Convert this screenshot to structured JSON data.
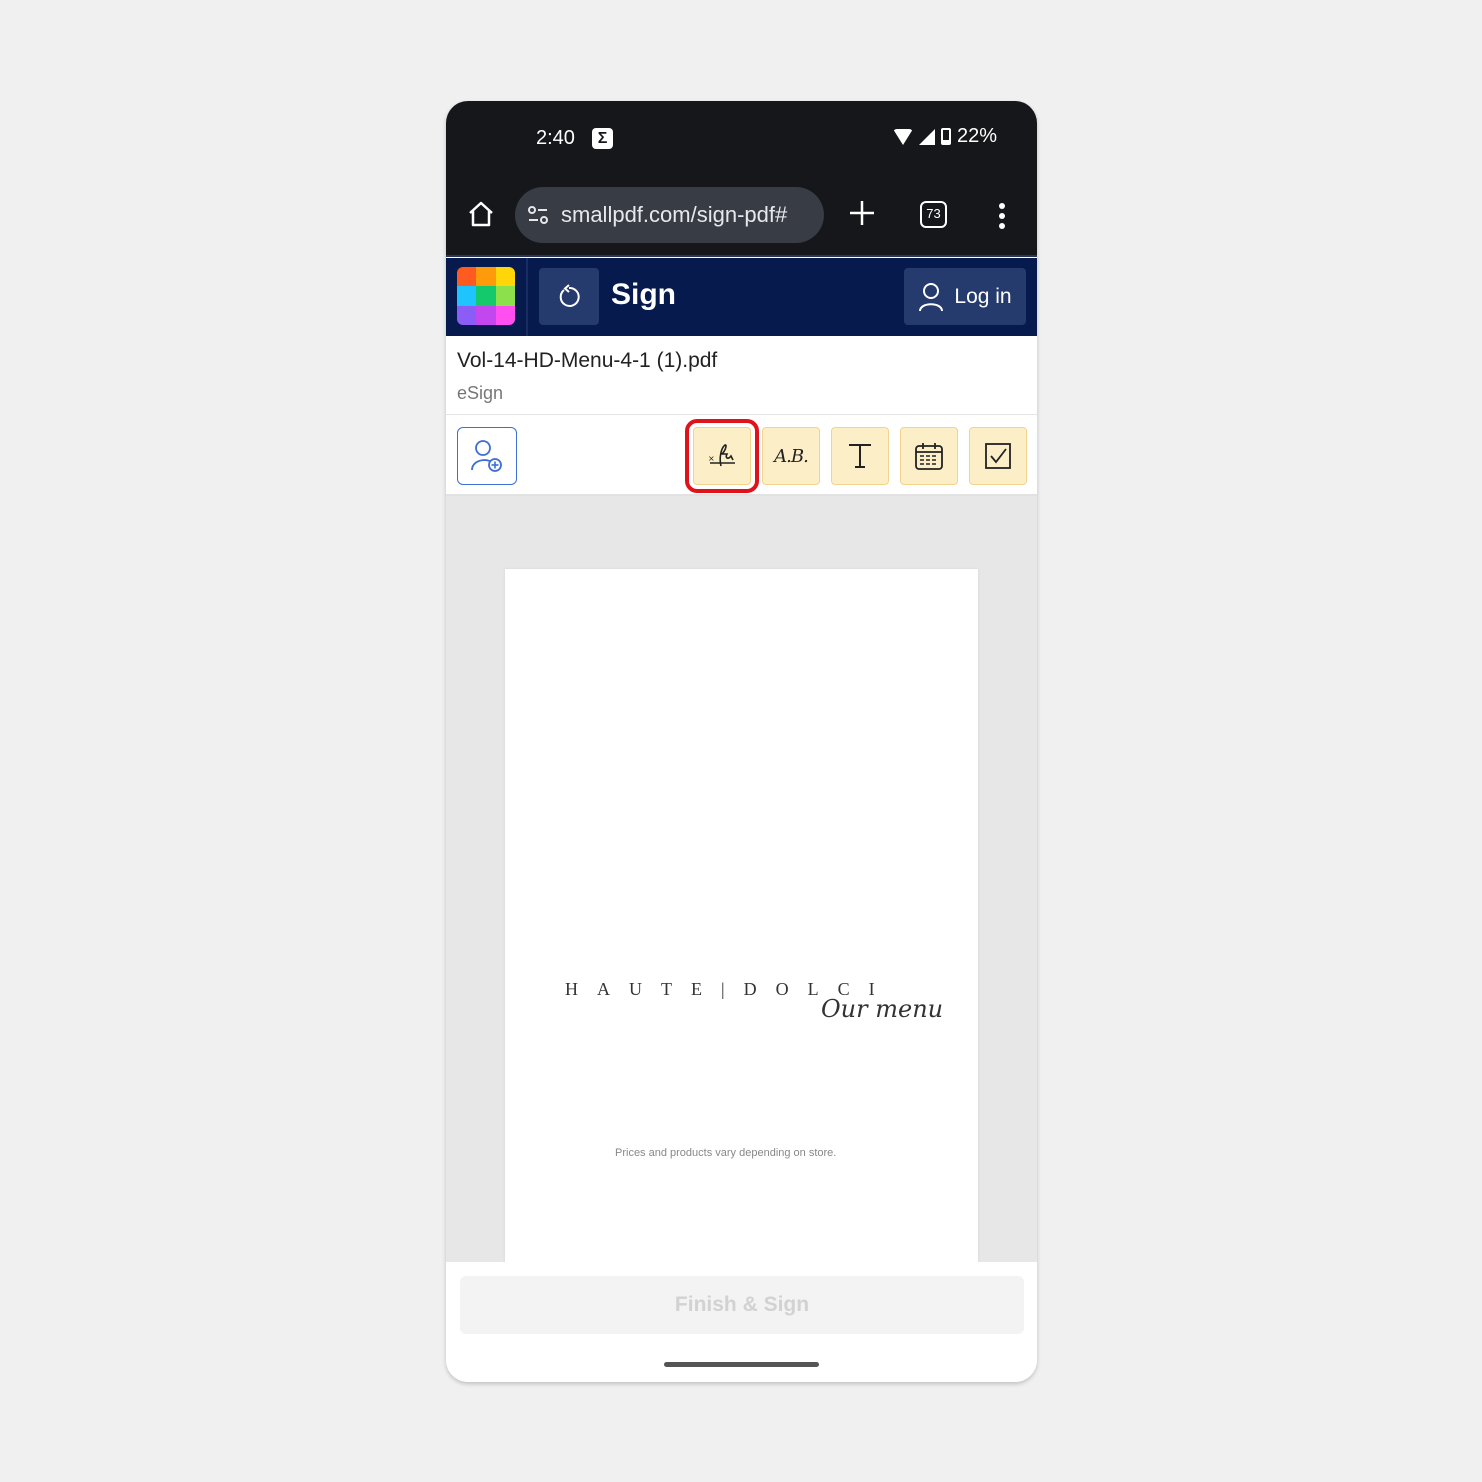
{
  "status_bar": {
    "time": "2:40",
    "notification_icon": "sigma-icon",
    "battery": "22%"
  },
  "browser": {
    "url": "smallpdf.com/sign-pdf#",
    "tab_count": "73"
  },
  "app_bar": {
    "title": "Sign",
    "login_label": "Log in",
    "logo_colors": [
      "#ff5a1f",
      "#ff9b0a",
      "#ffd60a",
      "#1fc4ff",
      "#14c96b",
      "#8be04c",
      "#8b5cf6",
      "#c247ee",
      "#ff4ff0"
    ]
  },
  "file": {
    "name": "Vol-14-HD-Menu-4-1 (1).pdf",
    "subtitle": "eSign"
  },
  "toolbar": {
    "tools": [
      {
        "name": "signature",
        "icon": "signature-icon",
        "selected": true
      },
      {
        "name": "initials",
        "icon": "initials-icon",
        "label": "A.B."
      },
      {
        "name": "text",
        "icon": "text-icon"
      },
      {
        "name": "date",
        "icon": "calendar-icon"
      },
      {
        "name": "checkbox",
        "icon": "checkbox-icon"
      }
    ],
    "accent_color": "#e0131a"
  },
  "document": {
    "brand": "HAUTE|DOLCI",
    "script_text": "Our menu",
    "fineprint": "Prices and products vary depending on store."
  },
  "footer": {
    "finish_label": "Finish & Sign"
  }
}
